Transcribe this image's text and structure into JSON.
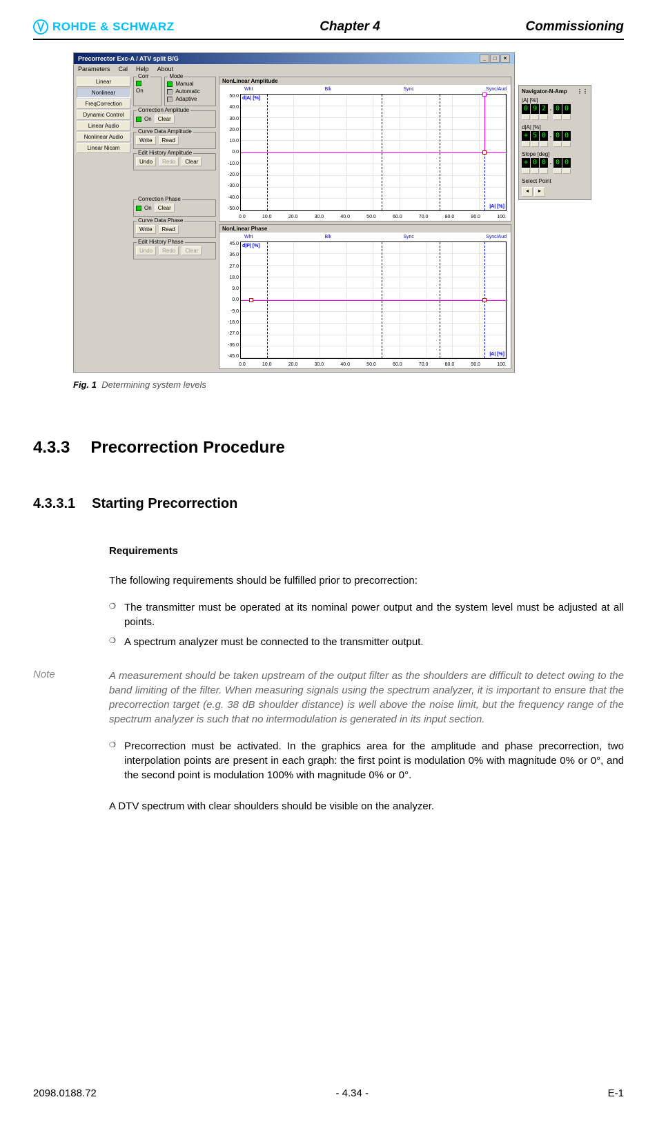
{
  "header": {
    "logo_text": "ROHDE & SCHWARZ",
    "chapter": "Chapter 4",
    "right": "Commissioning"
  },
  "app": {
    "title": "Precorrector Exc-A / ATV split B/G",
    "menu": [
      "Parameters",
      "Cal",
      "Help",
      "About"
    ],
    "sidebar": [
      "Linear",
      "Nonlinear",
      "FreqCorrection",
      "Dynamic Control",
      "Linear Audio",
      "Nonlinear Audio",
      "Linear Nicam"
    ],
    "panels": {
      "corr": {
        "title": "Corr",
        "on": "On"
      },
      "mode": {
        "title": "Mode",
        "items": [
          "Manual",
          "Automatic",
          "Adaptive"
        ]
      },
      "corr_amp": {
        "title": "Correction Amplitude",
        "on": "On",
        "clear": "Clear"
      },
      "curve_amp": {
        "title": "Curve Data Amplitude",
        "write": "Write",
        "read": "Read"
      },
      "edit_amp": {
        "title": "Edit History Amplitude",
        "undo": "Undo",
        "redo": "Redo",
        "clear": "Clear"
      },
      "corr_ph": {
        "title": "Correction Phase",
        "on": "On",
        "clear": "Clear"
      },
      "curve_ph": {
        "title": "Curve Data Phase",
        "write": "Write",
        "read": "Read"
      },
      "edit_ph": {
        "title": "Edit History Phase",
        "undo": "Undo",
        "redo": "Redo",
        "clear": "Clear"
      }
    },
    "chart_top": {
      "title": "NonLinear Amplitude",
      "markers": [
        "Wht",
        "Blk",
        "Sync",
        "Sync/Aud"
      ],
      "ylabel": "d|A| [%]",
      "xlabel": "|A| [%]"
    },
    "chart_bottom": {
      "title": "NonLinear Phase",
      "markers": [
        "Wht",
        "Blk",
        "Sync",
        "Sync/Aud"
      ],
      "ylabel": "d|P| [%]",
      "xlabel": "|A| [%]"
    }
  },
  "navigator": {
    "title": "Navigator-N-Amp",
    "fields": {
      "a": {
        "label": "|A| [%]",
        "digits": [
          "0",
          "9",
          "2",
          ".",
          "0",
          "0"
        ]
      },
      "da": {
        "label": "d|A| [%]",
        "digits": [
          "+",
          "5",
          "0",
          ".",
          "0",
          "0"
        ]
      },
      "slope": {
        "label": "Slope [deg]",
        "digits": [
          "+",
          "0",
          "0",
          ".",
          "0",
          "0"
        ]
      }
    },
    "select_label": "Select Point"
  },
  "chart_data": [
    {
      "type": "line",
      "title": "NonLinear Amplitude",
      "xlabel": "|A| [%]",
      "ylabel": "d|A| [%]",
      "xlim": [
        0,
        100
      ],
      "ylim": [
        -50,
        50
      ],
      "x_ticks": [
        0,
        10,
        20,
        30,
        40,
        50,
        60,
        70,
        80,
        90,
        100
      ],
      "y_ticks": [
        -50,
        -40,
        -30,
        -20,
        -10,
        0,
        10,
        20,
        30,
        40,
        50
      ],
      "markers": {
        "Wht": 10,
        "Blk": 53,
        "Sync": 75,
        "Sync/Aud": 92
      },
      "series": [
        {
          "name": "curve",
          "x": [
            0,
            92
          ],
          "y": [
            0,
            0
          ]
        },
        {
          "name": "segment",
          "x": [
            92,
            92
          ],
          "y": [
            0,
            50
          ]
        }
      ],
      "points": [
        {
          "x": 92,
          "y": 0
        },
        {
          "x": 92,
          "y": 50
        }
      ]
    },
    {
      "type": "line",
      "title": "NonLinear Phase",
      "xlabel": "|A| [%]",
      "ylabel": "d|P| [%]",
      "xlim": [
        0,
        100
      ],
      "ylim": [
        -45,
        45
      ],
      "x_ticks": [
        0,
        10,
        20,
        30,
        40,
        50,
        60,
        70,
        80,
        90,
        100
      ],
      "y_ticks": [
        -45,
        -36,
        -27,
        -18,
        -9,
        0,
        9,
        18,
        27,
        36,
        45
      ],
      "markers": {
        "Wht": 10,
        "Blk": 53,
        "Sync": 75,
        "Sync/Aud": 92
      },
      "series": [
        {
          "name": "curve",
          "x": [
            0,
            100
          ],
          "y": [
            0,
            0
          ]
        }
      ],
      "points": [
        {
          "x": 4,
          "y": 0
        },
        {
          "x": 92,
          "y": 0
        }
      ]
    }
  ],
  "caption": {
    "fig": "Fig. 1",
    "text": "Determining system levels"
  },
  "sec1": {
    "num": "4.3.3",
    "title": "Precorrection Procedure"
  },
  "sec2": {
    "num": "4.3.3.1",
    "title": "Starting Precorrection"
  },
  "req_h": "Requirements",
  "req_intro": "The following requirements should be fulfilled prior to precorrection:",
  "bullets1": [
    "The transmitter must be operated at its nominal power output and the system level must be adjusted at all points.",
    "A spectrum analyzer must be connected to the transmitter output."
  ],
  "note": {
    "label": "Note",
    "text": "A measurement should be taken upstream of the output filter as the shoulders are difficult to detect owing to the band limiting of the filter. When measuring signals using the spectrum analyzer, it is important to ensure that the precorrection target (e.g. 38 dB shoulder distance) is well above the noise limit, but the frequency range of the spectrum analyzer is such that no intermodulation is generated in its input section."
  },
  "bullets2": [
    "Precorrection must be activated. In the graphics area for the amplitude and phase precorrection, two interpolation points are present in each graph: the first point is modulation 0% with magnitude 0% or 0°, and the second point is modulation 100% with magnitude 0% or 0°."
  ],
  "closing": "A DTV spectrum with clear shoulders should be visible on the analyzer.",
  "footer": {
    "left": "2098.0188.72",
    "center": "- 4.34 -",
    "right": "E-1"
  }
}
